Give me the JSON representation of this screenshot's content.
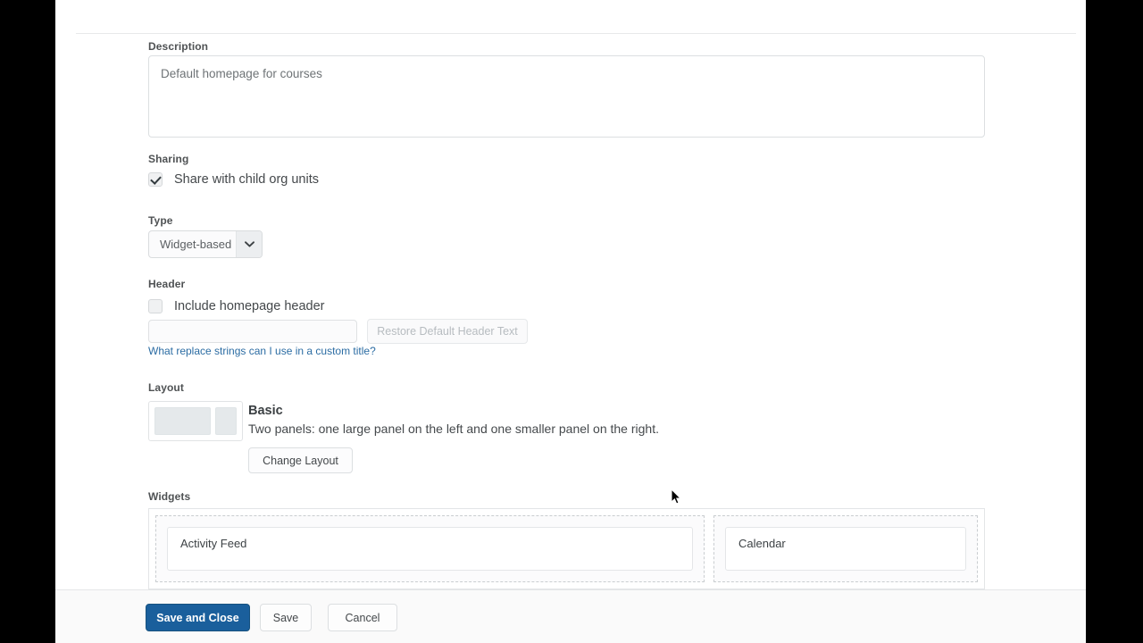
{
  "form": {
    "description": {
      "label": "Description",
      "value": "Default homepage for courses"
    },
    "sharing": {
      "label": "Sharing",
      "checkbox_label": "Share with child org units",
      "checked": true
    },
    "type": {
      "label": "Type",
      "selected": "Widget-based",
      "options": [
        "Widget-based"
      ]
    },
    "header": {
      "label": "Header",
      "include_label": "Include homepage header",
      "include_checked": false,
      "custom_title_value": "",
      "restore_button": "Restore Default Header Text",
      "restore_button_disabled": true,
      "replace_strings_link": "What replace strings can I use in a custom title?"
    },
    "layout": {
      "label": "Layout",
      "name": "Basic",
      "description": "Two panels: one large panel on the left and one smaller panel on the right.",
      "change_button": "Change Layout"
    },
    "widgets": {
      "label": "Widgets",
      "panels": [
        {
          "position": "left",
          "items": [
            {
              "title": "Activity Feed"
            }
          ]
        },
        {
          "position": "right",
          "items": [
            {
              "title": "Calendar"
            }
          ]
        }
      ]
    }
  },
  "actions": {
    "save_and_close": "Save and Close",
    "save": "Save",
    "cancel": "Cancel"
  },
  "colors": {
    "primary_button": "#1a5f9c",
    "link": "#2b6ca3",
    "label_text": "#4f5254"
  }
}
